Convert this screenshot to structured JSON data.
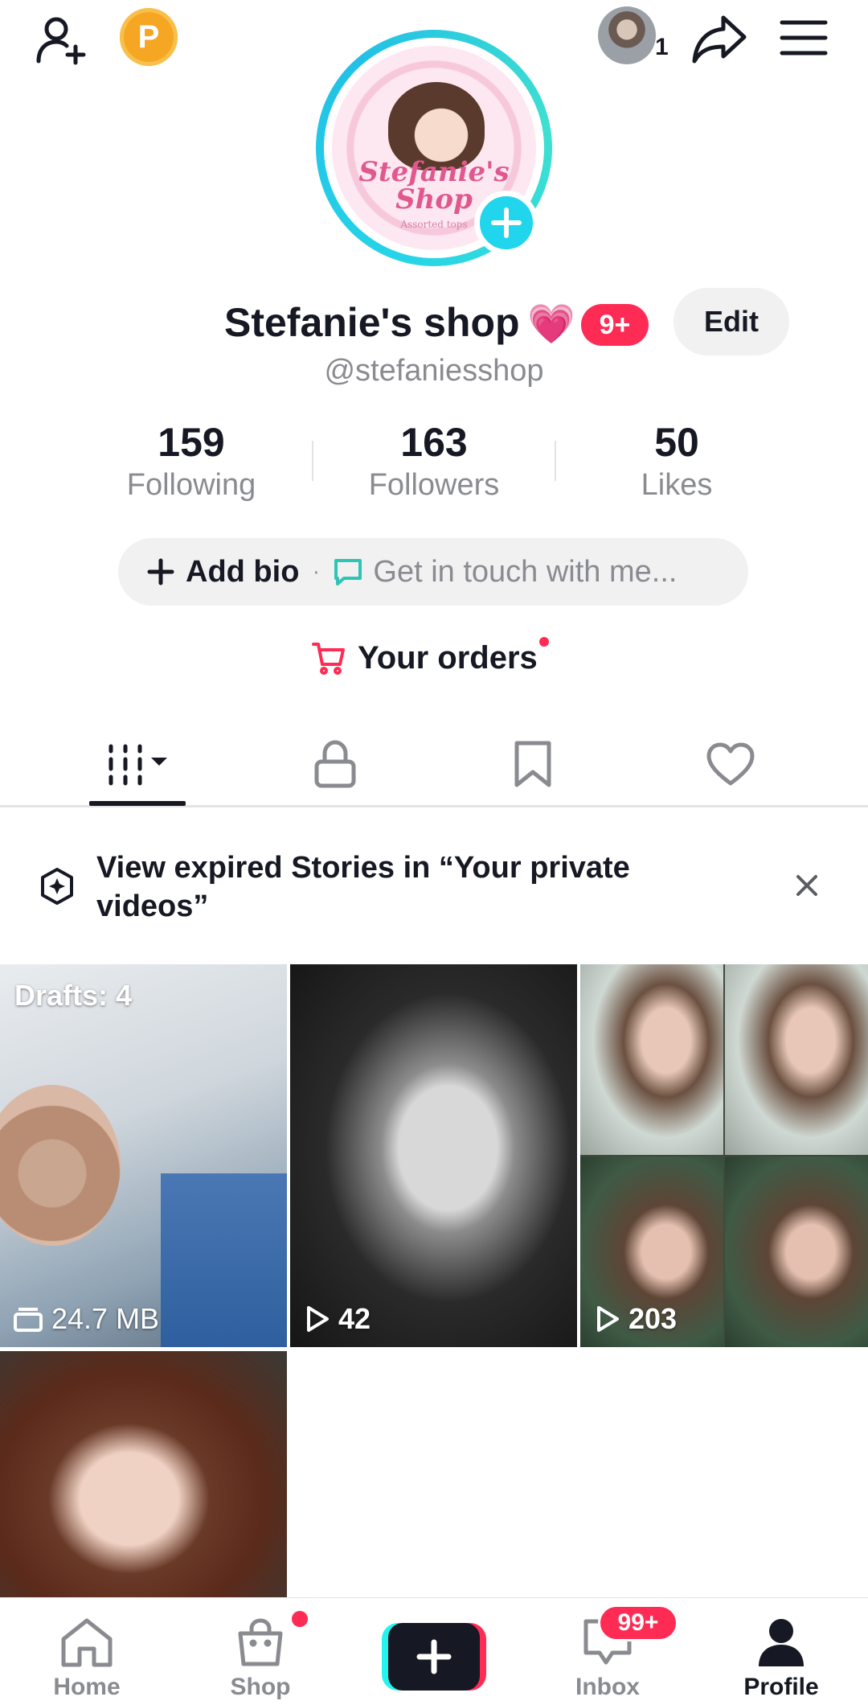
{
  "top_bar": {
    "coin_label": "P",
    "visitor_count": "1"
  },
  "profile": {
    "avatar_text": "Stefanie's Shop",
    "avatar_subtext": "Assorted tops",
    "display_name": "Stefanie's shop",
    "name_emoji": "💗",
    "name_badge": "9+",
    "edit_label": "Edit",
    "username": "@stefaniesshop"
  },
  "stats": [
    {
      "value": "159",
      "label": "Following"
    },
    {
      "value": "163",
      "label": "Followers"
    },
    {
      "value": "50",
      "label": "Likes"
    }
  ],
  "bio": {
    "add_label": "Add bio",
    "separator": "·",
    "contact_label": "Get in touch with me..."
  },
  "orders": {
    "label": "Your orders"
  },
  "tabs": [
    "videos-grid",
    "private",
    "favorites",
    "liked"
  ],
  "banner": {
    "text": "View expired Stories in “Your private videos”"
  },
  "grid": {
    "drafts_label": "Drafts: 4",
    "drafts_size": "24.7 MB",
    "video1_views": "42",
    "video2_views": "203"
  },
  "bottom_nav": {
    "home": "Home",
    "shop": "Shop",
    "inbox": "Inbox",
    "inbox_badge": "99+",
    "profile": "Profile"
  },
  "colors": {
    "accent_pink": "#fe2c55",
    "accent_cyan": "#25f4ee",
    "ring": "#20d5ec",
    "text": "#161823",
    "muted": "#8a8b91"
  }
}
